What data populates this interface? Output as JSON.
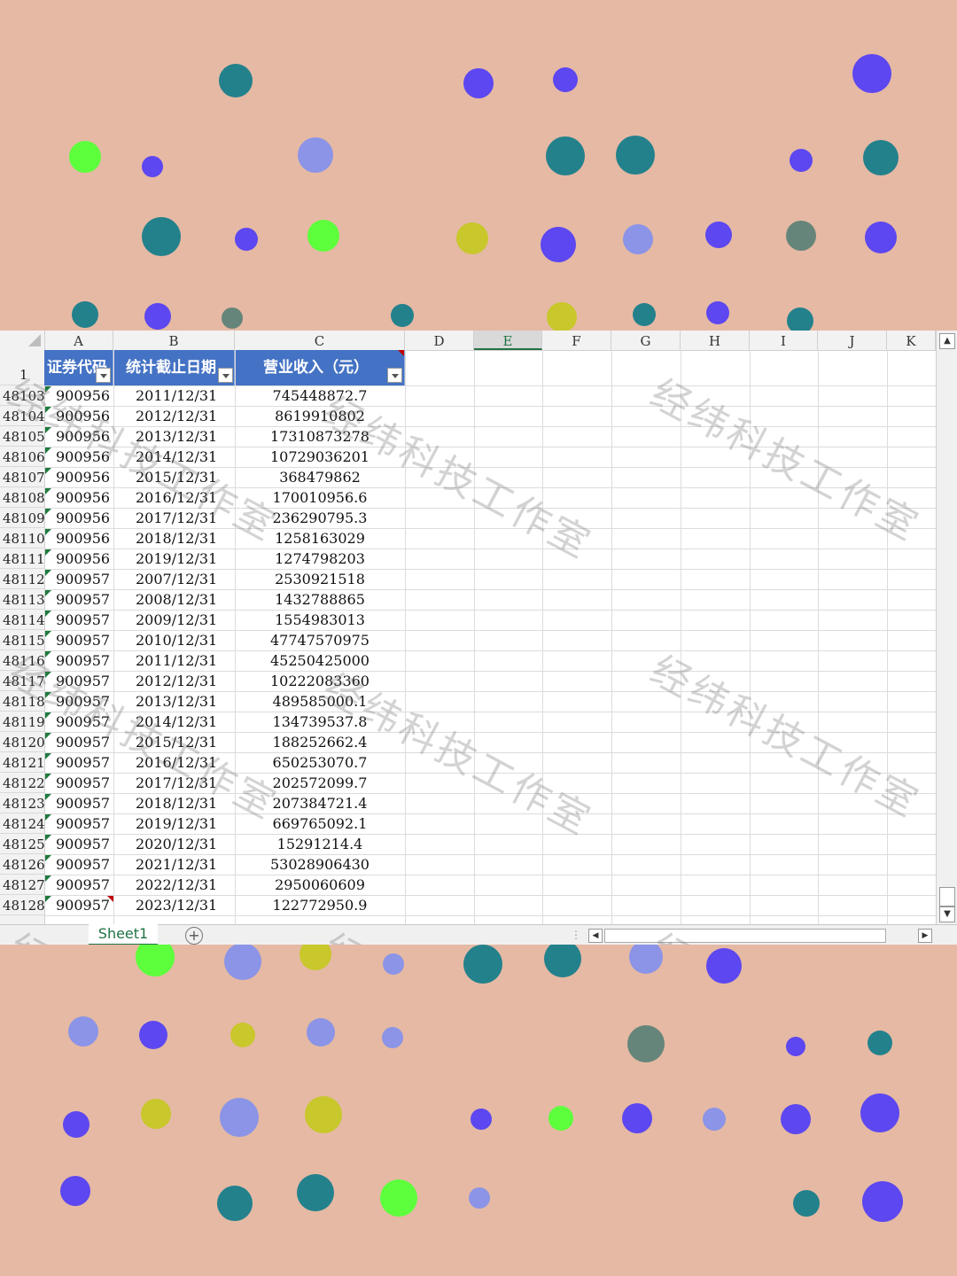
{
  "spreadsheet": {
    "columns": [
      "A",
      "B",
      "C",
      "D",
      "E",
      "F",
      "G",
      "H",
      "I",
      "J",
      "K"
    ],
    "selected_column": "E",
    "header_row_number": "1",
    "headers": [
      "证券代码",
      "统计截止日期",
      "营业收入（元）"
    ],
    "rows": [
      {
        "num": "48103",
        "code": "900956",
        "date": "2011/12/31",
        "revenue": "745448872.7"
      },
      {
        "num": "48104",
        "code": "900956",
        "date": "2012/12/31",
        "revenue": "8619910802"
      },
      {
        "num": "48105",
        "code": "900956",
        "date": "2013/12/31",
        "revenue": "17310873278"
      },
      {
        "num": "48106",
        "code": "900956",
        "date": "2014/12/31",
        "revenue": "10729036201"
      },
      {
        "num": "48107",
        "code": "900956",
        "date": "2015/12/31",
        "revenue": "368479862"
      },
      {
        "num": "48108",
        "code": "900956",
        "date": "2016/12/31",
        "revenue": "170010956.6"
      },
      {
        "num": "48109",
        "code": "900956",
        "date": "2017/12/31",
        "revenue": "236290795.3"
      },
      {
        "num": "48110",
        "code": "900956",
        "date": "2018/12/31",
        "revenue": "1258163029"
      },
      {
        "num": "48111",
        "code": "900956",
        "date": "2019/12/31",
        "revenue": "1274798203"
      },
      {
        "num": "48112",
        "code": "900957",
        "date": "2007/12/31",
        "revenue": "2530921518"
      },
      {
        "num": "48113",
        "code": "900957",
        "date": "2008/12/31",
        "revenue": "1432788865"
      },
      {
        "num": "48114",
        "code": "900957",
        "date": "2009/12/31",
        "revenue": "1554983013"
      },
      {
        "num": "48115",
        "code": "900957",
        "date": "2010/12/31",
        "revenue": "47747570975"
      },
      {
        "num": "48116",
        "code": "900957",
        "date": "2011/12/31",
        "revenue": "45250425000"
      },
      {
        "num": "48117",
        "code": "900957",
        "date": "2012/12/31",
        "revenue": "10222083360"
      },
      {
        "num": "48118",
        "code": "900957",
        "date": "2013/12/31",
        "revenue": "489585000.1"
      },
      {
        "num": "48119",
        "code": "900957",
        "date": "2014/12/31",
        "revenue": "134739537.8"
      },
      {
        "num": "48120",
        "code": "900957",
        "date": "2015/12/31",
        "revenue": "188252662.4"
      },
      {
        "num": "48121",
        "code": "900957",
        "date": "2016/12/31",
        "revenue": "650253070.7"
      },
      {
        "num": "48122",
        "code": "900957",
        "date": "2017/12/31",
        "revenue": "202572099.7"
      },
      {
        "num": "48123",
        "code": "900957",
        "date": "2018/12/31",
        "revenue": "207384721.4"
      },
      {
        "num": "48124",
        "code": "900957",
        "date": "2019/12/31",
        "revenue": "669765092.1"
      },
      {
        "num": "48125",
        "code": "900957",
        "date": "2020/12/31",
        "revenue": "15291214.4"
      },
      {
        "num": "48126",
        "code": "900957",
        "date": "2021/12/31",
        "revenue": "53028906430"
      },
      {
        "num": "48127",
        "code": "900957",
        "date": "2022/12/31",
        "revenue": "2950060609"
      },
      {
        "num": "48128",
        "code": "900957",
        "date": "2023/12/31",
        "revenue": "122772950.9"
      }
    ]
  },
  "sheet_tab": "Sheet1",
  "icons": {
    "add_sheet": "plus-circle-icon",
    "scroll_up": "triangle-up-icon",
    "scroll_down": "triangle-down-icon",
    "scroll_left": "triangle-left-icon",
    "scroll_right": "triangle-right-icon"
  },
  "watermark": "经纬科技工作室",
  "colors": {
    "background": "#e5b9a4",
    "header_fill": "#4472c4",
    "accent": "#217346"
  }
}
